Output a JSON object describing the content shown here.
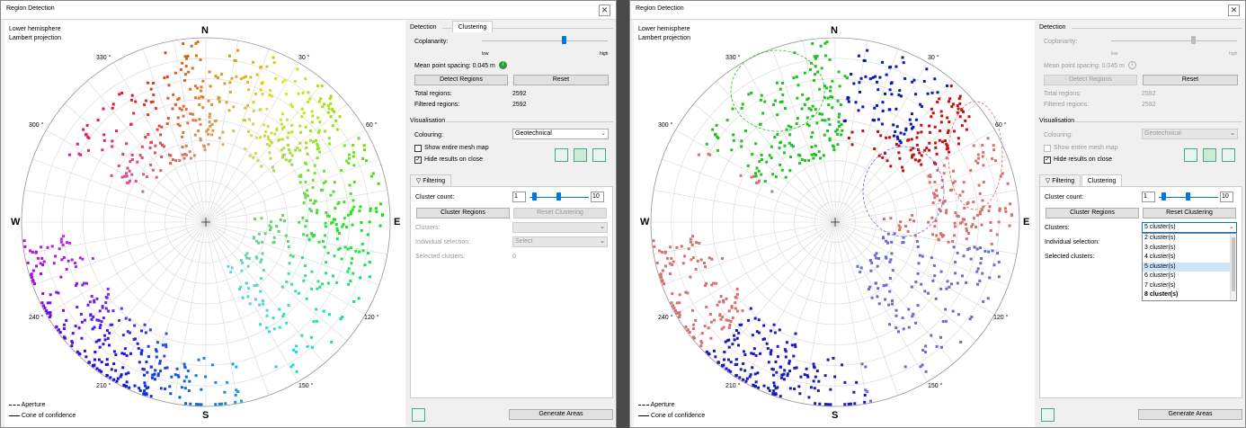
{
  "windows": [
    {
      "title": "Region Detection",
      "plot": {
        "hemisphere": "Lower hemisphere",
        "projection": "Lambert projection",
        "compass": {
          "n": "N",
          "s": "S",
          "e": "E",
          "w": "W"
        },
        "angles": {
          "a330": "330 °",
          "a30": "30 °",
          "a300": "300 °",
          "a60": "60 °",
          "a240": "240 °",
          "a120": "120 °",
          "a210": "210 °",
          "a150": "150 °"
        },
        "legend_aperture": "Aperture",
        "legend_cone": "Cone of confidence"
      },
      "detection": {
        "title": "Detection",
        "coplanarity_label": "Coplanarity:",
        "low": "low",
        "high": "high",
        "coplanarity_level": 0.65,
        "mean_spacing_label": "Mean point spacing: 0.045 m",
        "detect_button": "Detect Regions",
        "reset_button": "Reset",
        "total_label": "Total regions:",
        "total_value": "2592",
        "filtered_label": "Filtered regions:",
        "filtered_value": "2592"
      },
      "visualisation": {
        "title": "Visualisation",
        "colouring_label": "Colouring:",
        "colouring_value": "Geotechnical",
        "show_mesh_label": "Show entire mesh map",
        "hide_results_label": "Hide results on close"
      },
      "tabs": {
        "filtering": "Filtering",
        "clustering": "Clustering"
      },
      "clustering": {
        "cluster_count_label": "Cluster count:",
        "count_min": "1",
        "count_max": "10",
        "cluster_regions_button": "Cluster Regions",
        "reset_clustering_button": "Reset Clustering",
        "clusters_label": "Clusters:",
        "clusters_value": "",
        "individual_label": "Individual selection:",
        "individual_value": "Select",
        "selected_label": "Selected clusters:",
        "selected_value": "0"
      },
      "generate_button": "Generate Areas"
    },
    {
      "title": "Region Detection",
      "plot": {
        "hemisphere": "Lower hemisphere",
        "projection": "Lambert projection",
        "compass": {
          "n": "N",
          "s": "S",
          "e": "E",
          "w": "W"
        },
        "angles": {
          "a330": "330 °",
          "a30": "30 °",
          "a300": "300 °",
          "a60": "60 °",
          "a240": "240 °",
          "a120": "120 °",
          "a210": "210 °",
          "a150": "150 °"
        },
        "legend_aperture": "Aperture",
        "legend_cone": "Cone of confidence"
      },
      "detection": {
        "title": "Detection",
        "coplanarity_label": "Coplanarity:",
        "low": "low",
        "high": "high",
        "coplanarity_level": 0.65,
        "mean_spacing_label": "Mean point spacing: 0.045 m",
        "detect_button": "Detect Regions",
        "reset_button": "Reset",
        "total_label": "Total regions:",
        "total_value": "2592",
        "filtered_label": "Filtered regions:",
        "filtered_value": "2592"
      },
      "visualisation": {
        "title": "Visualisation",
        "colouring_label": "Colouring:",
        "colouring_value": "Geotechnical",
        "show_mesh_label": "Show entire mesh map",
        "hide_results_label": "Hide results on close"
      },
      "tabs": {
        "filtering": "Filtering",
        "clustering": "Clustering"
      },
      "clustering": {
        "cluster_count_label": "Cluster count:",
        "count_min": "1",
        "count_max": "10",
        "cluster_regions_button": "Cluster Regions",
        "reset_clustering_button": "Reset Clustering",
        "clusters_label": "Clusters:",
        "clusters_value": "5 cluster(s)",
        "dropdown_options": [
          "2 cluster(s)",
          "3 cluster(s)",
          "4 cluster(s)",
          "5 cluster(s)",
          "6 cluster(s)",
          "7 cluster(s)",
          "8 cluster(s)"
        ],
        "individual_label": "Individual selection:",
        "selected_label": "Selected clusters:"
      },
      "generate_button": "Generate Areas"
    }
  ]
}
